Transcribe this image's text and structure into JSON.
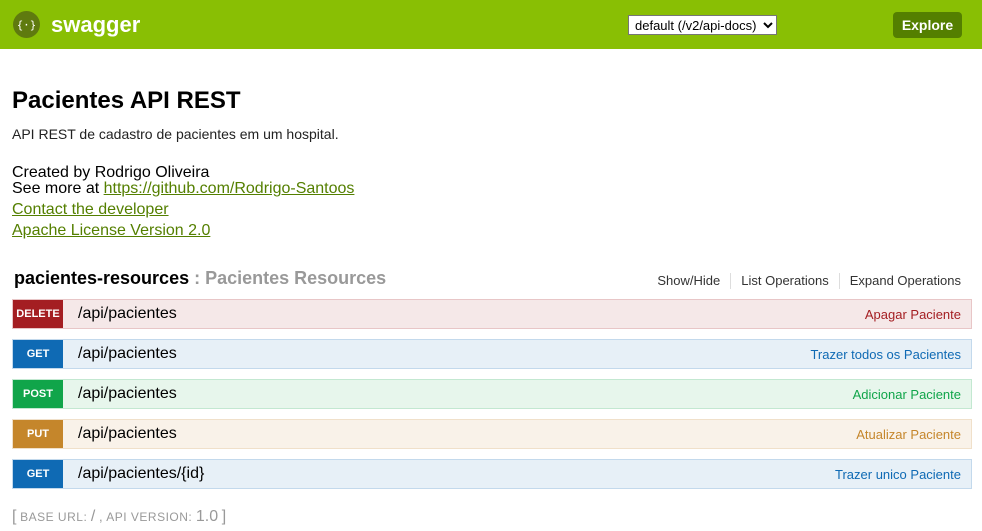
{
  "header": {
    "logo_text": "swagger",
    "logo_icon": "swagger-braces-icon",
    "spec_select_value": "default (/v2/api-docs)",
    "explore_label": "Explore",
    "bg_color": "#89bf04"
  },
  "info": {
    "title": "Pacientes API REST",
    "description": "API REST de cadastro de pacientes em um hospital.",
    "created_by": "Created by Rodrigo Oliveira",
    "see_more_prefix": "See more at ",
    "see_more_link": "https://github.com/Rodrigo-Santoos",
    "contact_link": "Contact the developer",
    "license_link": "Apache License Version 2.0"
  },
  "resource": {
    "name": "pacientes-resources",
    "separator": " : ",
    "description": "Pacientes Resources",
    "actions": [
      "Show/Hide",
      "List Operations",
      "Expand Operations"
    ]
  },
  "operations": [
    {
      "method": "DELETE",
      "path": "/api/pacientes",
      "summary": "Apagar Paciente",
      "color": "#a41e22"
    },
    {
      "method": "GET",
      "path": "/api/pacientes",
      "summary": "Trazer todos os Pacientes",
      "color": "#0f6ab4"
    },
    {
      "method": "POST",
      "path": "/api/pacientes",
      "summary": "Adicionar Paciente",
      "color": "#10a54a"
    },
    {
      "method": "PUT",
      "path": "/api/pacientes",
      "summary": "Atualizar Paciente",
      "color": "#c5862b"
    },
    {
      "method": "GET",
      "path": "/api/pacientes/{id}",
      "summary": "Trazer unico Paciente",
      "color": "#0f6ab4"
    }
  ],
  "footer": {
    "open_bracket": "[",
    "base_url_label": "BASE URL",
    "base_url_value": "/",
    "api_version_label": "API VERSION",
    "api_version_value": "1.0",
    "close_bracket": "]"
  }
}
